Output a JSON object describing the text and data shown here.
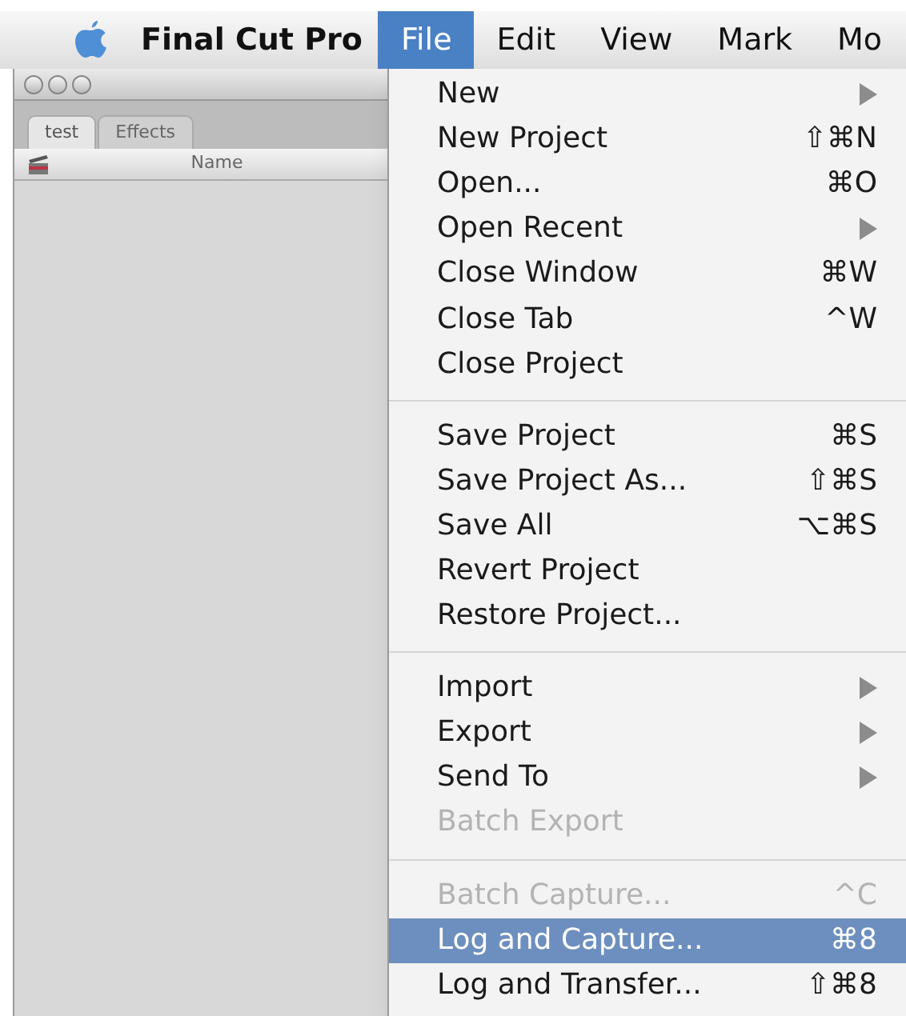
{
  "menu_bar": {
    "app_name": "Final Cut Pro",
    "menus": [
      {
        "label": "File",
        "selected": true
      },
      {
        "label": "Edit",
        "selected": false
      },
      {
        "label": "View",
        "selected": false
      },
      {
        "label": "Mark",
        "selected": false
      },
      {
        "label": "Mo",
        "selected": false
      }
    ]
  },
  "browser_window": {
    "tabs": [
      {
        "label": "test",
        "selected": true
      },
      {
        "label": "Effects",
        "selected": false
      }
    ],
    "column_header": "Name"
  },
  "file_menu": {
    "groups": [
      [
        {
          "label": "New",
          "submenu": true,
          "disabled": false,
          "selected": false
        },
        {
          "label": "New Project",
          "shortcut": "⇧⌘N",
          "submenu": false,
          "disabled": false,
          "selected": false
        },
        {
          "label": "Open...",
          "shortcut": "⌘O",
          "submenu": false,
          "disabled": false,
          "selected": false
        },
        {
          "label": "Open Recent",
          "submenu": true,
          "disabled": false,
          "selected": false
        },
        {
          "label": "Close Window",
          "shortcut": "⌘W",
          "submenu": false,
          "disabled": false,
          "selected": false
        },
        {
          "label": "Close Tab",
          "shortcut": "^W",
          "submenu": false,
          "disabled": false,
          "selected": false
        },
        {
          "label": "Close Project",
          "submenu": false,
          "disabled": false,
          "selected": false
        }
      ],
      [
        {
          "label": "Save Project",
          "shortcut": "⌘S",
          "submenu": false,
          "disabled": false,
          "selected": false
        },
        {
          "label": "Save Project As...",
          "shortcut": "⇧⌘S",
          "submenu": false,
          "disabled": false,
          "selected": false
        },
        {
          "label": "Save All",
          "shortcut": "⌥⌘S",
          "submenu": false,
          "disabled": false,
          "selected": false
        },
        {
          "label": "Revert Project",
          "submenu": false,
          "disabled": false,
          "selected": false
        },
        {
          "label": "Restore Project...",
          "submenu": false,
          "disabled": false,
          "selected": false
        }
      ],
      [
        {
          "label": "Import",
          "submenu": true,
          "disabled": false,
          "selected": false
        },
        {
          "label": "Export",
          "submenu": true,
          "disabled": false,
          "selected": false
        },
        {
          "label": "Send To",
          "submenu": true,
          "disabled": false,
          "selected": false
        },
        {
          "label": "Batch Export",
          "submenu": false,
          "disabled": true,
          "selected": false
        }
      ],
      [
        {
          "label": "Batch Capture...",
          "shortcut": "^C",
          "submenu": false,
          "disabled": true,
          "selected": false
        },
        {
          "label": "Log and Capture...",
          "shortcut": "⌘8",
          "submenu": false,
          "disabled": false,
          "selected": true
        },
        {
          "label": "Log and Transfer...",
          "shortcut": "⇧⌘8",
          "submenu": false,
          "disabled": false,
          "selected": false
        }
      ]
    ]
  }
}
